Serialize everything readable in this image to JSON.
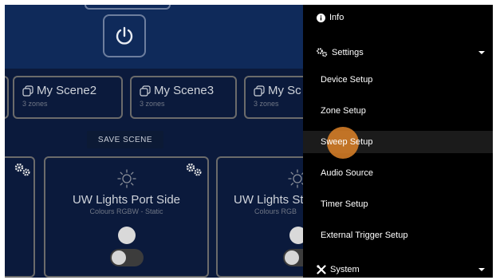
{
  "scenes": [
    {
      "name": "My Scene2",
      "zones": "3 zones"
    },
    {
      "name": "My Scene3",
      "zones": "3 zones"
    },
    {
      "name": "My Sc",
      "zones": "3 zones"
    }
  ],
  "save_scene_label": "SAVE SCENE",
  "zones": [
    {
      "name": "UW Lights Port Side",
      "mode": "Colours RGBW - Static"
    },
    {
      "name": "UW Lights Sta",
      "mode": "Colours RGB"
    }
  ],
  "menu": {
    "info": "Info",
    "settings": "Settings",
    "settings_items": [
      "Device Setup",
      "Zone Setup",
      "Sweep Setup",
      "Audio Source",
      "Timer Setup",
      "External Trigger Setup"
    ],
    "system": "System"
  },
  "colors": {
    "top_background": "#0f2a5a",
    "panel_background": "#0b1a3c",
    "menu_background": "#000000",
    "click_marker": "#de8228"
  }
}
